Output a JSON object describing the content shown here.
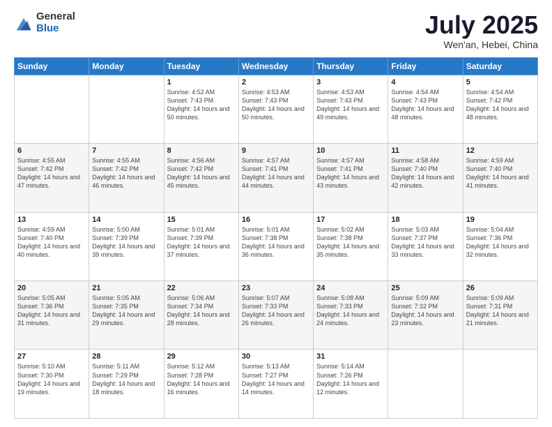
{
  "logo": {
    "general": "General",
    "blue": "Blue"
  },
  "header": {
    "month": "July 2025",
    "location": "Wen'an, Hebei, China"
  },
  "days_of_week": [
    "Sunday",
    "Monday",
    "Tuesday",
    "Wednesday",
    "Thursday",
    "Friday",
    "Saturday"
  ],
  "weeks": [
    [
      {
        "day": "",
        "sunrise": "",
        "sunset": "",
        "daylight": "",
        "empty": true
      },
      {
        "day": "",
        "sunrise": "",
        "sunset": "",
        "daylight": "",
        "empty": true
      },
      {
        "day": "1",
        "sunrise": "Sunrise: 4:52 AM",
        "sunset": "Sunset: 7:43 PM",
        "daylight": "Daylight: 14 hours and 50 minutes."
      },
      {
        "day": "2",
        "sunrise": "Sunrise: 4:53 AM",
        "sunset": "Sunset: 7:43 PM",
        "daylight": "Daylight: 14 hours and 50 minutes."
      },
      {
        "day": "3",
        "sunrise": "Sunrise: 4:53 AM",
        "sunset": "Sunset: 7:43 PM",
        "daylight": "Daylight: 14 hours and 49 minutes."
      },
      {
        "day": "4",
        "sunrise": "Sunrise: 4:54 AM",
        "sunset": "Sunset: 7:43 PM",
        "daylight": "Daylight: 14 hours and 48 minutes."
      },
      {
        "day": "5",
        "sunrise": "Sunrise: 4:54 AM",
        "sunset": "Sunset: 7:42 PM",
        "daylight": "Daylight: 14 hours and 48 minutes."
      }
    ],
    [
      {
        "day": "6",
        "sunrise": "Sunrise: 4:55 AM",
        "sunset": "Sunset: 7:42 PM",
        "daylight": "Daylight: 14 hours and 47 minutes."
      },
      {
        "day": "7",
        "sunrise": "Sunrise: 4:55 AM",
        "sunset": "Sunset: 7:42 PM",
        "daylight": "Daylight: 14 hours and 46 minutes."
      },
      {
        "day": "8",
        "sunrise": "Sunrise: 4:56 AM",
        "sunset": "Sunset: 7:42 PM",
        "daylight": "Daylight: 14 hours and 45 minutes."
      },
      {
        "day": "9",
        "sunrise": "Sunrise: 4:57 AM",
        "sunset": "Sunset: 7:41 PM",
        "daylight": "Daylight: 14 hours and 44 minutes."
      },
      {
        "day": "10",
        "sunrise": "Sunrise: 4:57 AM",
        "sunset": "Sunset: 7:41 PM",
        "daylight": "Daylight: 14 hours and 43 minutes."
      },
      {
        "day": "11",
        "sunrise": "Sunrise: 4:58 AM",
        "sunset": "Sunset: 7:40 PM",
        "daylight": "Daylight: 14 hours and 42 minutes."
      },
      {
        "day": "12",
        "sunrise": "Sunrise: 4:59 AM",
        "sunset": "Sunset: 7:40 PM",
        "daylight": "Daylight: 14 hours and 41 minutes."
      }
    ],
    [
      {
        "day": "13",
        "sunrise": "Sunrise: 4:59 AM",
        "sunset": "Sunset: 7:40 PM",
        "daylight": "Daylight: 14 hours and 40 minutes."
      },
      {
        "day": "14",
        "sunrise": "Sunrise: 5:00 AM",
        "sunset": "Sunset: 7:39 PM",
        "daylight": "Daylight: 14 hours and 39 minutes."
      },
      {
        "day": "15",
        "sunrise": "Sunrise: 5:01 AM",
        "sunset": "Sunset: 7:39 PM",
        "daylight": "Daylight: 14 hours and 37 minutes."
      },
      {
        "day": "16",
        "sunrise": "Sunrise: 5:01 AM",
        "sunset": "Sunset: 7:38 PM",
        "daylight": "Daylight: 14 hours and 36 minutes."
      },
      {
        "day": "17",
        "sunrise": "Sunrise: 5:02 AM",
        "sunset": "Sunset: 7:38 PM",
        "daylight": "Daylight: 14 hours and 35 minutes."
      },
      {
        "day": "18",
        "sunrise": "Sunrise: 5:03 AM",
        "sunset": "Sunset: 7:37 PM",
        "daylight": "Daylight: 14 hours and 33 minutes."
      },
      {
        "day": "19",
        "sunrise": "Sunrise: 5:04 AM",
        "sunset": "Sunset: 7:36 PM",
        "daylight": "Daylight: 14 hours and 32 minutes."
      }
    ],
    [
      {
        "day": "20",
        "sunrise": "Sunrise: 5:05 AM",
        "sunset": "Sunset: 7:36 PM",
        "daylight": "Daylight: 14 hours and 31 minutes."
      },
      {
        "day": "21",
        "sunrise": "Sunrise: 5:05 AM",
        "sunset": "Sunset: 7:35 PM",
        "daylight": "Daylight: 14 hours and 29 minutes."
      },
      {
        "day": "22",
        "sunrise": "Sunrise: 5:06 AM",
        "sunset": "Sunset: 7:34 PM",
        "daylight": "Daylight: 14 hours and 28 minutes."
      },
      {
        "day": "23",
        "sunrise": "Sunrise: 5:07 AM",
        "sunset": "Sunset: 7:33 PM",
        "daylight": "Daylight: 14 hours and 26 minutes."
      },
      {
        "day": "24",
        "sunrise": "Sunrise: 5:08 AM",
        "sunset": "Sunset: 7:33 PM",
        "daylight": "Daylight: 14 hours and 24 minutes."
      },
      {
        "day": "25",
        "sunrise": "Sunrise: 5:09 AM",
        "sunset": "Sunset: 7:32 PM",
        "daylight": "Daylight: 14 hours and 23 minutes."
      },
      {
        "day": "26",
        "sunrise": "Sunrise: 5:09 AM",
        "sunset": "Sunset: 7:31 PM",
        "daylight": "Daylight: 14 hours and 21 minutes."
      }
    ],
    [
      {
        "day": "27",
        "sunrise": "Sunrise: 5:10 AM",
        "sunset": "Sunset: 7:30 PM",
        "daylight": "Daylight: 14 hours and 19 minutes."
      },
      {
        "day": "28",
        "sunrise": "Sunrise: 5:11 AM",
        "sunset": "Sunset: 7:29 PM",
        "daylight": "Daylight: 14 hours and 18 minutes."
      },
      {
        "day": "29",
        "sunrise": "Sunrise: 5:12 AM",
        "sunset": "Sunset: 7:28 PM",
        "daylight": "Daylight: 14 hours and 16 minutes."
      },
      {
        "day": "30",
        "sunrise": "Sunrise: 5:13 AM",
        "sunset": "Sunset: 7:27 PM",
        "daylight": "Daylight: 14 hours and 14 minutes."
      },
      {
        "day": "31",
        "sunrise": "Sunrise: 5:14 AM",
        "sunset": "Sunset: 7:26 PM",
        "daylight": "Daylight: 14 hours and 12 minutes."
      },
      {
        "day": "",
        "sunrise": "",
        "sunset": "",
        "daylight": "",
        "empty": true
      },
      {
        "day": "",
        "sunrise": "",
        "sunset": "",
        "daylight": "",
        "empty": true
      }
    ]
  ]
}
